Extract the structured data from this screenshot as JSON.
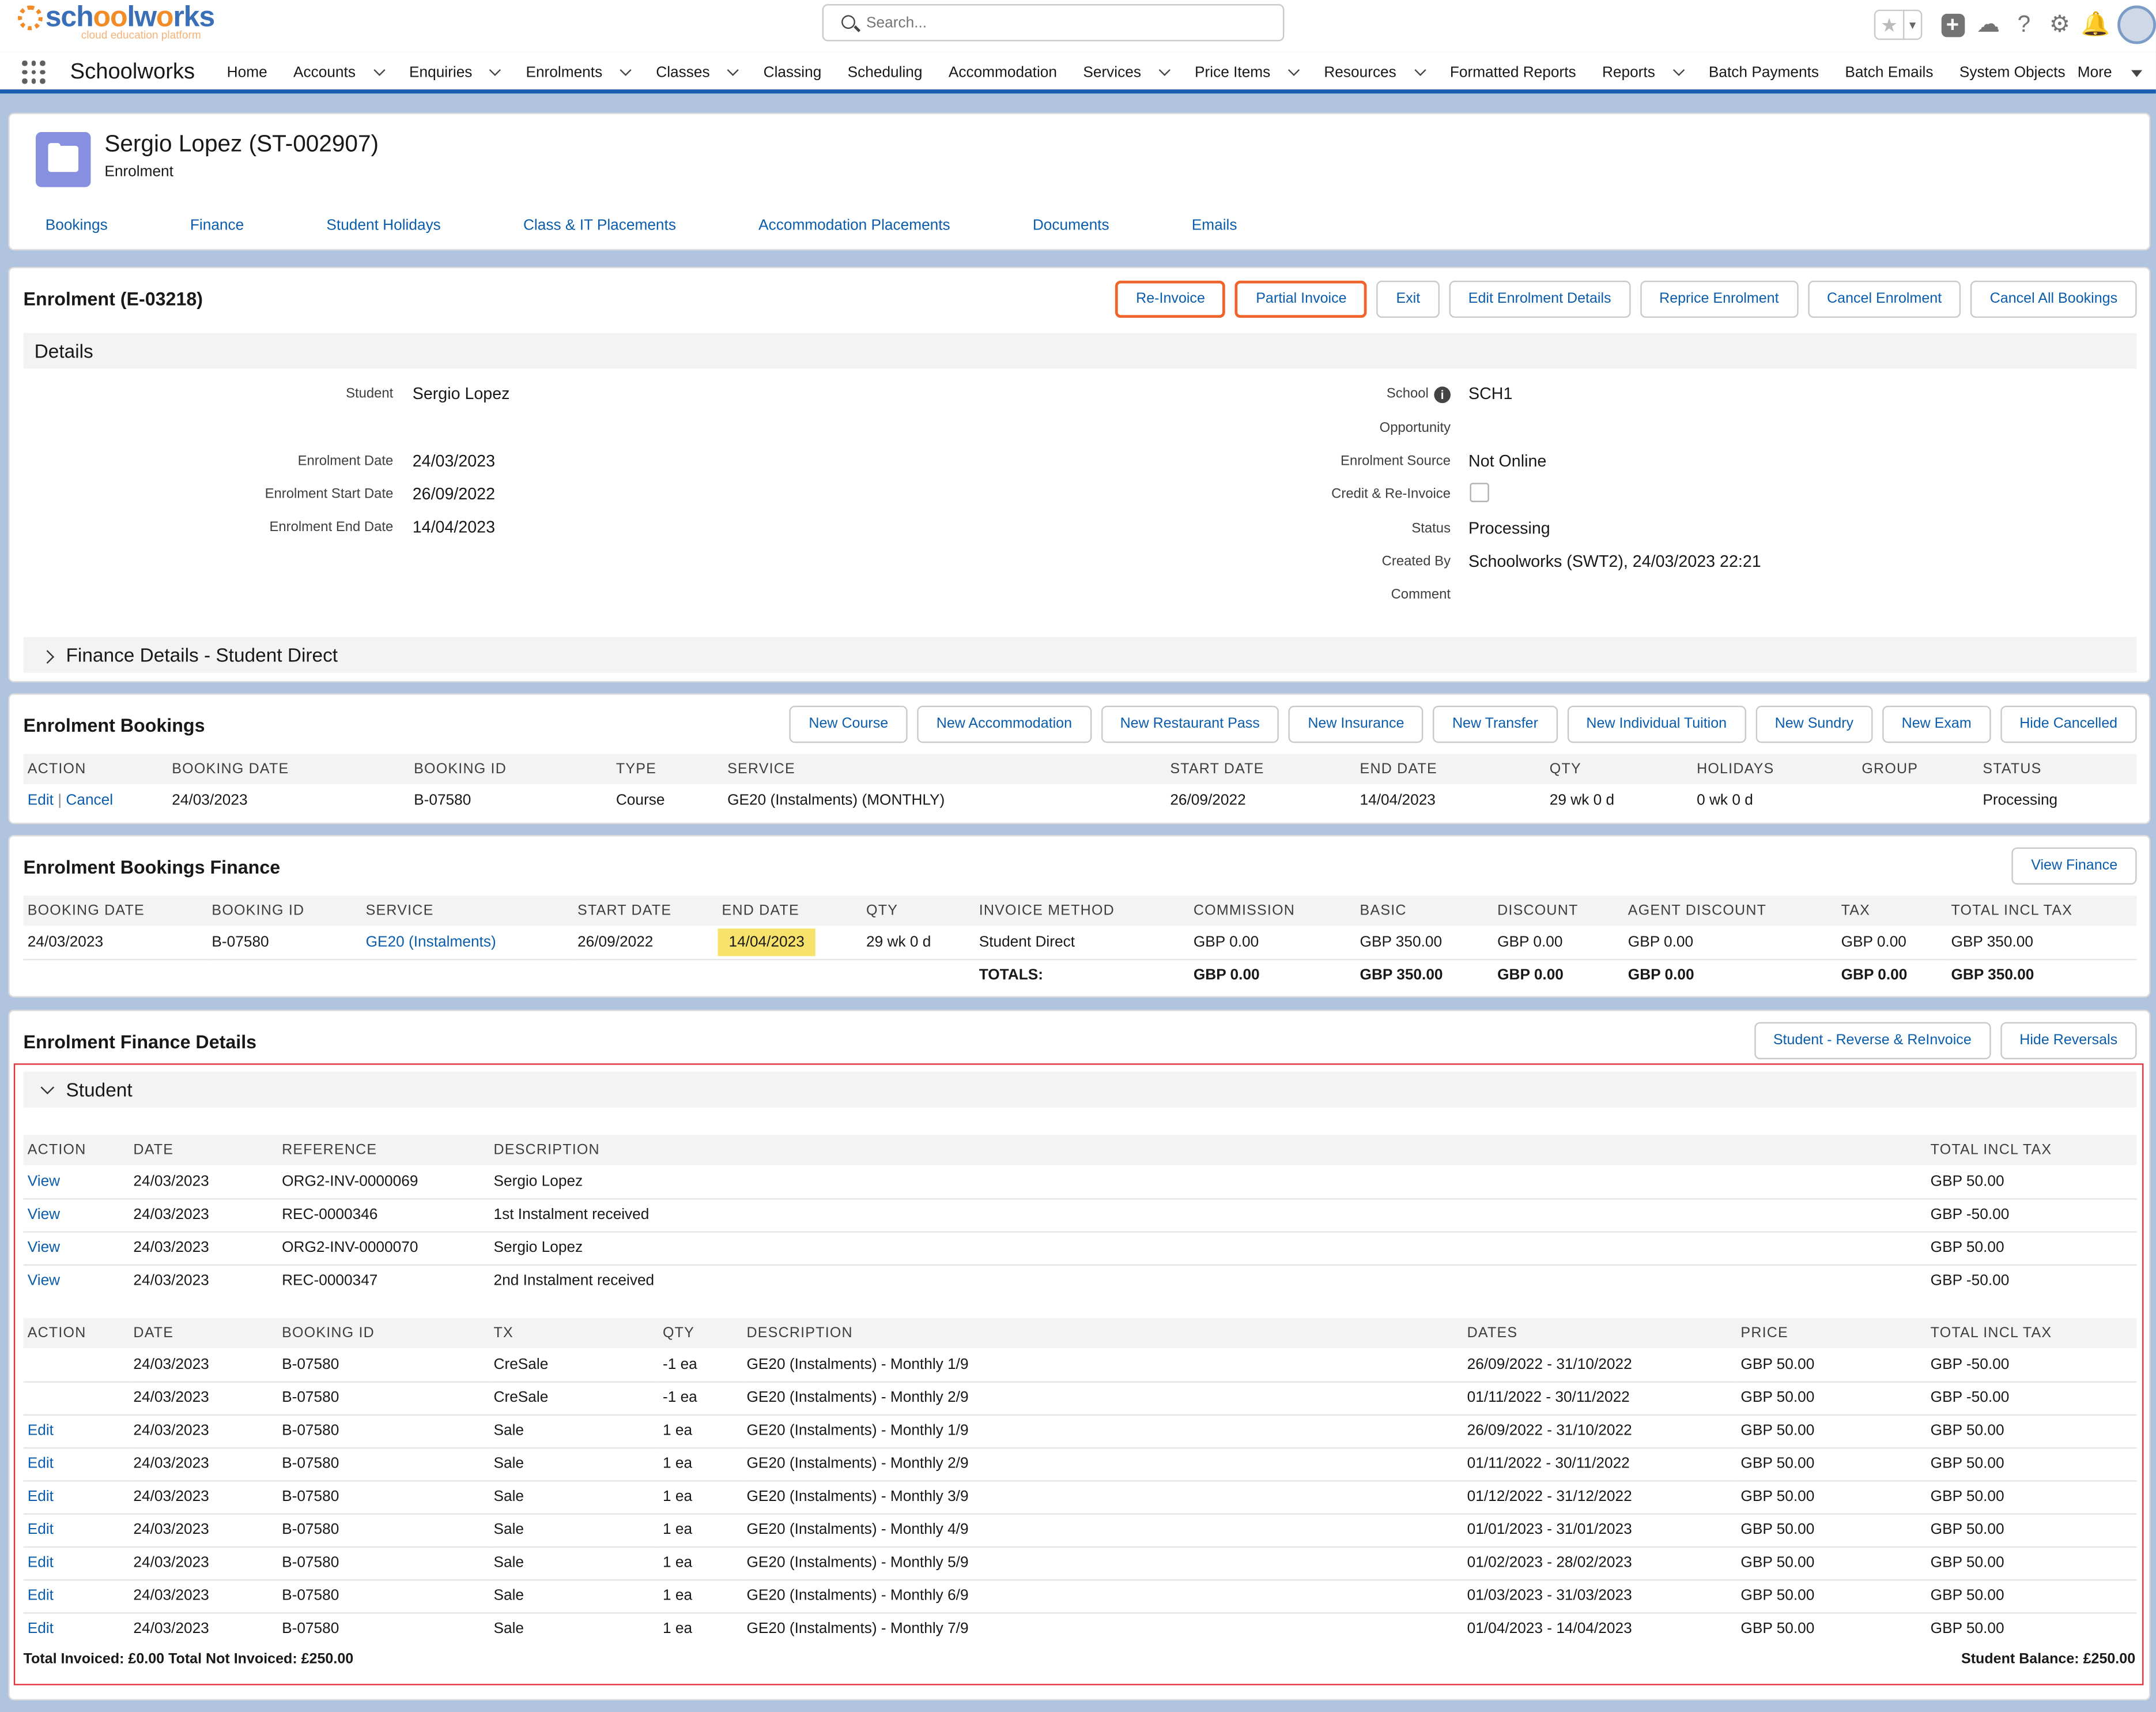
{
  "header": {
    "logo_main": "schoolworks",
    "logo_sub": "cloud education platform",
    "search_placeholder": "Search...",
    "icons": [
      "star-icon",
      "add-icon",
      "cloud-icon",
      "help-icon",
      "gear-icon",
      "bell-icon",
      "avatar"
    ]
  },
  "nav": {
    "app_name": "Schoolworks",
    "items": [
      {
        "label": "Home",
        "dropdown": false
      },
      {
        "label": "Accounts",
        "dropdown": true
      },
      {
        "label": "Enquiries",
        "dropdown": true
      },
      {
        "label": "Enrolments",
        "dropdown": true
      },
      {
        "label": "Classes",
        "dropdown": true
      },
      {
        "label": "Classing",
        "dropdown": false
      },
      {
        "label": "Scheduling",
        "dropdown": false
      },
      {
        "label": "Accommodation",
        "dropdown": false
      },
      {
        "label": "Services",
        "dropdown": true
      },
      {
        "label": "Price Items",
        "dropdown": true
      },
      {
        "label": "Resources",
        "dropdown": true
      },
      {
        "label": "Formatted Reports",
        "dropdown": false
      },
      {
        "label": "Reports",
        "dropdown": true
      },
      {
        "label": "Batch Payments",
        "dropdown": false
      },
      {
        "label": "Batch Emails",
        "dropdown": false
      },
      {
        "label": "System Objects",
        "dropdown": false
      }
    ],
    "more": "More"
  },
  "record": {
    "title": "Sergio Lopez (ST-002907)",
    "subtitle": "Enrolment",
    "tabs": [
      "Bookings",
      "Finance",
      "Student Holidays",
      "Class & IT Placements",
      "Accommodation Placements",
      "Documents",
      "Emails"
    ]
  },
  "enrolment": {
    "title": "Enrolment (E-03218)",
    "buttons": [
      {
        "label": "Re-Invoice",
        "highlight": true
      },
      {
        "label": "Partial Invoice",
        "highlight": true
      },
      {
        "label": "Exit",
        "highlight": false
      },
      {
        "label": "Edit Enrolment Details",
        "highlight": false
      },
      {
        "label": "Reprice Enrolment",
        "highlight": false
      },
      {
        "label": "Cancel Enrolment",
        "highlight": false
      },
      {
        "label": "Cancel All Bookings",
        "highlight": false
      }
    ],
    "details_label": "Details",
    "student_label": "Student",
    "student": "Sergio Lopez",
    "enrol_date_label": "Enrolment Date",
    "enrol_date": "24/03/2023",
    "start_label": "Enrolment Start Date",
    "start": "26/09/2022",
    "end_label": "Enrolment End Date",
    "end": "14/04/2023",
    "school_label": "School",
    "school": "SCH1",
    "opportunity_label": "Opportunity",
    "source_label": "Enrolment Source",
    "source": "Not Online",
    "credit_label": "Credit & Re-Invoice",
    "status_label": "Status",
    "status": "Processing",
    "created_label": "Created By",
    "created": "Schoolworks (SWT2), 24/03/2023 22:21",
    "comment_label": "Comment",
    "finance_details": "Finance Details - Student Direct"
  },
  "bookings": {
    "title": "Enrolment Bookings",
    "buttons": [
      "New Course",
      "New Accommodation",
      "New Restaurant Pass",
      "New Insurance",
      "New Transfer",
      "New Individual Tuition",
      "New Sundry",
      "New Exam",
      "Hide Cancelled"
    ],
    "headers": [
      "ACTION",
      "BOOKING DATE",
      "BOOKING ID",
      "TYPE",
      "SERVICE",
      "START DATE",
      "END DATE",
      "QTY",
      "HOLIDAYS",
      "GROUP",
      "STATUS"
    ],
    "row": {
      "edit": "Edit",
      "cancel": "Cancel",
      "date": "24/03/2023",
      "id": "B-07580",
      "type": "Course",
      "service": "GE20 (Instalments) (MONTHLY)",
      "start": "26/09/2022",
      "end": "14/04/2023",
      "qty": "29 wk 0 d",
      "holidays": "0 wk 0 d",
      "group": "",
      "status": "Processing"
    }
  },
  "bfin": {
    "title": "Enrolment Bookings Finance",
    "button": "View Finance",
    "headers": [
      "BOOKING DATE",
      "BOOKING ID",
      "SERVICE",
      "START DATE",
      "END DATE",
      "QTY",
      "INVOICE METHOD",
      "COMMISSION",
      "BASIC",
      "DISCOUNT",
      "AGENT DISCOUNT",
      "TAX",
      "TOTAL INCL TAX"
    ],
    "row": {
      "date": "24/03/2023",
      "id": "B-07580",
      "service": "GE20 (Instalments)",
      "start": "26/09/2022",
      "end": "14/04/2023",
      "qty": "29 wk 0 d",
      "method": "Student Direct",
      "commission": "GBP 0.00",
      "basic": "GBP 350.00",
      "discount": "GBP 0.00",
      "agent": "GBP 0.00",
      "tax": "GBP 0.00",
      "total": "GBP 350.00"
    },
    "totals": {
      "label": "TOTALS:",
      "commission": "GBP 0.00",
      "basic": "GBP 350.00",
      "discount": "GBP 0.00",
      "agent": "GBP 0.00",
      "tax": "GBP 0.00",
      "total": "GBP 350.00"
    }
  },
  "efin": {
    "title": "Enrolment Finance Details",
    "buttons": [
      "Student - Reverse & ReInvoice",
      "Hide Reversals"
    ],
    "section": "Student",
    "inv_headers": [
      "ACTION",
      "DATE",
      "REFERENCE",
      "DESCRIPTION",
      "TOTAL INCL TAX"
    ],
    "invoices": [
      {
        "action": "View",
        "date": "24/03/2023",
        "ref": "ORG2-INV-0000069",
        "desc": "Sergio Lopez",
        "total": "GBP 50.00"
      },
      {
        "action": "View",
        "date": "24/03/2023",
        "ref": "REC-0000346",
        "desc": "1st Instalment received",
        "total": "GBP -50.00"
      },
      {
        "action": "View",
        "date": "24/03/2023",
        "ref": "ORG2-INV-0000070",
        "desc": "Sergio Lopez",
        "total": "GBP 50.00"
      },
      {
        "action": "View",
        "date": "24/03/2023",
        "ref": "REC-0000347",
        "desc": "2nd Instalment received",
        "total": "GBP -50.00"
      }
    ],
    "line_headers": [
      "ACTION",
      "DATE",
      "BOOKING ID",
      "TX",
      "QTY",
      "DESCRIPTION",
      "DATES",
      "PRICE",
      "TOTAL INCL TAX"
    ],
    "lines": [
      {
        "action": "",
        "date": "24/03/2023",
        "id": "B-07580",
        "tx": "CreSale",
        "qty": "-1 ea",
        "desc": "GE20 (Instalments) - Monthly 1/9",
        "dates": "26/09/2022 - 31/10/2022",
        "price": "GBP 50.00",
        "total": "GBP -50.00"
      },
      {
        "action": "",
        "date": "24/03/2023",
        "id": "B-07580",
        "tx": "CreSale",
        "qty": "-1 ea",
        "desc": "GE20 (Instalments) - Monthly 2/9",
        "dates": "01/11/2022 - 30/11/2022",
        "price": "GBP 50.00",
        "total": "GBP -50.00"
      },
      {
        "action": "Edit",
        "date": "24/03/2023",
        "id": "B-07580",
        "tx": "Sale",
        "qty": "1 ea",
        "desc": "GE20 (Instalments) - Monthly 1/9",
        "dates": "26/09/2022 - 31/10/2022",
        "price": "GBP 50.00",
        "total": "GBP 50.00"
      },
      {
        "action": "Edit",
        "date": "24/03/2023",
        "id": "B-07580",
        "tx": "Sale",
        "qty": "1 ea",
        "desc": "GE20 (Instalments) - Monthly 2/9",
        "dates": "01/11/2022 - 30/11/2022",
        "price": "GBP 50.00",
        "total": "GBP 50.00"
      },
      {
        "action": "Edit",
        "date": "24/03/2023",
        "id": "B-07580",
        "tx": "Sale",
        "qty": "1 ea",
        "desc": "GE20 (Instalments) - Monthly 3/9",
        "dates": "01/12/2022 - 31/12/2022",
        "price": "GBP 50.00",
        "total": "GBP 50.00"
      },
      {
        "action": "Edit",
        "date": "24/03/2023",
        "id": "B-07580",
        "tx": "Sale",
        "qty": "1 ea",
        "desc": "GE20 (Instalments) - Monthly 4/9",
        "dates": "01/01/2023 - 31/01/2023",
        "price": "GBP 50.00",
        "total": "GBP 50.00"
      },
      {
        "action": "Edit",
        "date": "24/03/2023",
        "id": "B-07580",
        "tx": "Sale",
        "qty": "1 ea",
        "desc": "GE20 (Instalments) - Monthly 5/9",
        "dates": "01/02/2023 - 28/02/2023",
        "price": "GBP 50.00",
        "total": "GBP 50.00"
      },
      {
        "action": "Edit",
        "date": "24/03/2023",
        "id": "B-07580",
        "tx": "Sale",
        "qty": "1 ea",
        "desc": "GE20 (Instalments) - Monthly 6/9",
        "dates": "01/03/2023 - 31/03/2023",
        "price": "GBP 50.00",
        "total": "GBP 50.00"
      },
      {
        "action": "Edit",
        "date": "24/03/2023",
        "id": "B-07580",
        "tx": "Sale",
        "qty": "1 ea",
        "desc": "GE20 (Instalments) - Monthly 7/9",
        "dates": "01/04/2023 - 14/04/2023",
        "price": "GBP 50.00",
        "total": "GBP 50.00"
      }
    ],
    "footer_left": "Total Invoiced: £0.00 Total Not Invoiced: £250.00",
    "footer_right": "Student Balance: £250.00"
  },
  "colors": {
    "link": "#0b5cab",
    "highlight_border": "#f0642b",
    "red_box": "#e2333a",
    "date_highlight": "#f7e26b",
    "nav_accent": "#1b5fb0"
  }
}
